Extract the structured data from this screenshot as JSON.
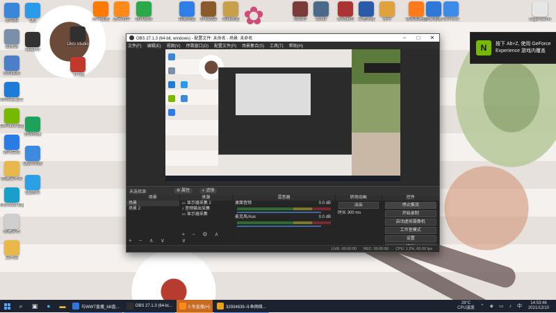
{
  "desktop": {
    "icons_left": [
      {
        "label": "此电脑",
        "icon": "computer-icon",
        "color": "#3a86d8"
      },
      {
        "label": "回收站",
        "icon": "recycle-bin-icon",
        "color": "#7b8fa8"
      },
      {
        "label": "控制面板",
        "icon": "control-panel-icon",
        "color": "#4c7fc7"
      },
      {
        "label": "360安全卫士",
        "icon": "shield-icon",
        "color": "#1e7bd8"
      },
      {
        "label": "GeForce Experience",
        "icon": "nvidia-icon",
        "color": "#76b900"
      },
      {
        "label": "腾讯会议",
        "icon": "meeting-icon",
        "color": "#2a7be4"
      },
      {
        "label": "新建文件夹",
        "icon": "folder-icon",
        "color": "#e8b84a"
      },
      {
        "label": "Microsoft Edge",
        "icon": "edge-icon",
        "color": "#1aa0c8"
      },
      {
        "label": "新建文本",
        "icon": "document-icon",
        "color": "#cfcfcf"
      },
      {
        "label": "文件夹",
        "icon": "folder-icon",
        "color": "#e8b84a"
      }
    ],
    "icons_col2": [
      {
        "label": "QQ",
        "icon": "qq-icon",
        "color": "#2a9be8"
      },
      {
        "label": "网易UU",
        "icon": "uu-icon",
        "color": "#333333"
      },
      {
        "label": "好游快爆",
        "icon": "game-icon",
        "color": "#1da35a"
      },
      {
        "label": "QQ浏览器",
        "icon": "browser-icon",
        "color": "#3c8be0"
      },
      {
        "label": "QQ音乐",
        "icon": "music-icon",
        "color": "#2ba0e4"
      }
    ],
    "icons_col3": [
      {
        "label": "OBS Studio",
        "icon": "obs-icon",
        "color": "#303030"
      },
      {
        "label": "飞行棋",
        "icon": "pirate-icon",
        "color": "#c0392b"
      }
    ],
    "icons_top": [
      {
        "label": "虎牙直播",
        "icon": "huya-icon",
        "color": "#ff7a00"
      },
      {
        "label": "虎牙助手",
        "icon": "huya-helper-icon",
        "color": "#ff8a1a"
      },
      {
        "label": "腾讯视频",
        "icon": "video-icon",
        "color": "#2ba84a"
      },
      {
        "label": "百度网盘",
        "icon": "cloud-icon",
        "color": "#2e7fe8"
      },
      {
        "label": "梦幻西游",
        "icon": "game-icon",
        "color": "#8a5a2a"
      },
      {
        "label": "英雄联盟",
        "icon": "lol-icon",
        "color": "#c8a04a"
      },
      {
        "label": "阴阳师",
        "icon": "game-icon",
        "color": "#7a3a3a"
      },
      {
        "label": "剑网3",
        "icon": "game-icon",
        "color": "#4a6a8a"
      },
      {
        "label": "永劫无间",
        "icon": "game-icon",
        "color": "#aa3333"
      },
      {
        "label": "王者荣耀",
        "icon": "game-icon",
        "color": "#2a5aa8"
      },
      {
        "label": "原神",
        "icon": "game-icon",
        "color": "#e0a23a"
      },
      {
        "label": "迅游加速器",
        "icon": "accelerator-icon",
        "color": "#ff7a1a"
      },
      {
        "label": "网易加速",
        "icon": "accelerator-icon",
        "color": "#2f78d8"
      },
      {
        "label": "GeForce",
        "icon": "geforce-icon",
        "color": "#3c8be8"
      },
      {
        "label": "cagio.demo",
        "icon": "file-icon",
        "color": "#e6e6e6"
      }
    ]
  },
  "toast": {
    "line1": "按下 Alt+Z, 使用 GeForce",
    "line2": "Experience 游戏内覆盖"
  },
  "obs": {
    "title": "OBS 27.1.3 (64-bit, windows) - 配置文件: 未命名 - 场景: 未命名",
    "menu": [
      "文件(F)",
      "编辑(E)",
      "视图(V)",
      "停靠窗口(D)",
      "配置文件(P)",
      "场景集合(S)",
      "工具(T)",
      "帮助(H)"
    ],
    "scene_bar": {
      "label": "未选择源",
      "btn1": "属性",
      "btn2": "滤镜"
    },
    "docks": {
      "scenes": {
        "title": "场景",
        "items": [
          "场景",
          "场景 2"
        ]
      },
      "sources": {
        "title": "来源",
        "items": [
          "显示器采集 2",
          "音频输出采集",
          "显示器采集"
        ]
      },
      "mixer": {
        "title": "混音器",
        "channels": [
          {
            "name": "桌面音频",
            "level": "0.0 dB"
          },
          {
            "name": "麦克风/Aux",
            "level": "0.0 dB"
          }
        ]
      },
      "transitions": {
        "title": "转场动画",
        "type": "淡出",
        "duration_label": "时长",
        "duration": "300 ms"
      },
      "controls": {
        "title": "控件",
        "buttons": [
          "停止推流",
          "开始录制",
          "启动虚拟摄像机",
          "工作室模式",
          "设置",
          "退出"
        ]
      }
    },
    "status": {
      "live": "LIVE: 00:00:00",
      "rec": "REC: 00:00:00",
      "cpu": "CPU: 1.2%, 60.00 fps"
    }
  },
  "taskbar": {
    "apps": [
      {
        "label": "与WWT直播_bili直...",
        "color": "#2f78d8",
        "active": false
      },
      {
        "label": "OBS 27.1.3 (64-bi...",
        "color": "#303030",
        "active": false
      },
      {
        "label": "0.免直播(H)",
        "color": "#ff8a1a",
        "active": true
      },
      {
        "label": "32934639-斗鱼网络...",
        "color": "#e8a020",
        "active": false
      }
    ],
    "weather": {
      "temp": "28°C",
      "desc": "CPU温度"
    },
    "time": "14:53:46",
    "date": "2021/12/10"
  }
}
